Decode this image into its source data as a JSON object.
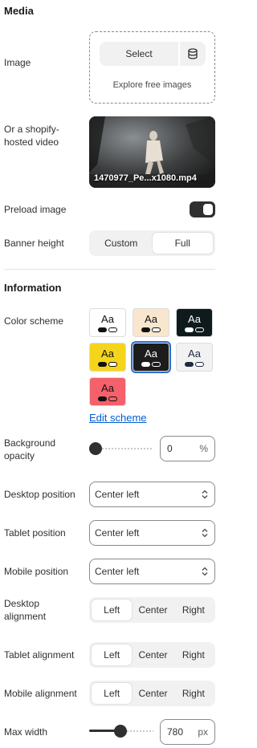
{
  "media": {
    "title": "Media",
    "image_label": "Image",
    "select_label": "Select",
    "explore_label": "Explore free images",
    "video_label": "Or a shopify-hosted video",
    "video_filename": "1470977_Pe...x1080.mp4",
    "preload_label": "Preload image",
    "preload_on": true,
    "banner_height_label": "Banner height",
    "banner_height_options": [
      "Custom",
      "Full"
    ],
    "banner_height_selected": "Full"
  },
  "information": {
    "title": "Information",
    "color_scheme_label": "Color scheme",
    "swatches": [
      {
        "text": "Aa",
        "bg": "#ffffff",
        "fg": "#111111",
        "pill1": "#111111",
        "pill2": "#ffffff"
      },
      {
        "text": "Aa",
        "bg": "#f9e6cf",
        "fg": "#111111",
        "pill1": "#111111",
        "pill2": "#ffffff"
      },
      {
        "text": "Aa",
        "bg": "#0f1a1c",
        "fg": "#ffffff",
        "pill1": "#ffffff",
        "pill2": "#0f1a1c"
      },
      {
        "text": "Aa",
        "bg": "#f4d51c",
        "fg": "#111111",
        "pill1": "#111111",
        "pill2": "#ffffff"
      },
      {
        "text": "Aa",
        "bg": "#1c1c1c",
        "fg": "#ffffff",
        "pill1": "#ffffff",
        "pill2": "#1c1c1c",
        "selected": true
      },
      {
        "text": "Aa",
        "bg": "#f2f2f2",
        "fg": "#1f2a44",
        "pill1": "#1f2a44",
        "pill2": "#ffffff"
      },
      {
        "text": "Aa",
        "bg": "#f4616a",
        "fg": "#111111",
        "pill1": "#111111",
        "pill2": "#f4616a"
      }
    ],
    "edit_scheme_label": "Edit scheme",
    "bg_opacity_label": "Background opacity",
    "bg_opacity_value": "0",
    "bg_opacity_unit": "%",
    "desktop_position_label": "Desktop position",
    "desktop_position_value": "Center left",
    "tablet_position_label": "Tablet position",
    "tablet_position_value": "Center left",
    "mobile_position_label": "Mobile position",
    "mobile_position_value": "Center left",
    "desktop_alignment_label": "Desktop alignment",
    "tablet_alignment_label": "Tablet alignment",
    "mobile_alignment_label": "Mobile alignment",
    "alignment_options": [
      "Left",
      "Center",
      "Right"
    ],
    "alignment_selected": "Left",
    "max_width_label": "Max width",
    "max_width_value": "780",
    "max_width_unit": "px",
    "max_width_fraction": 0.48
  },
  "colors": {
    "accent": "#005bd3",
    "selected_outline": "#2c6ecb",
    "toggle_on": "#303030"
  }
}
